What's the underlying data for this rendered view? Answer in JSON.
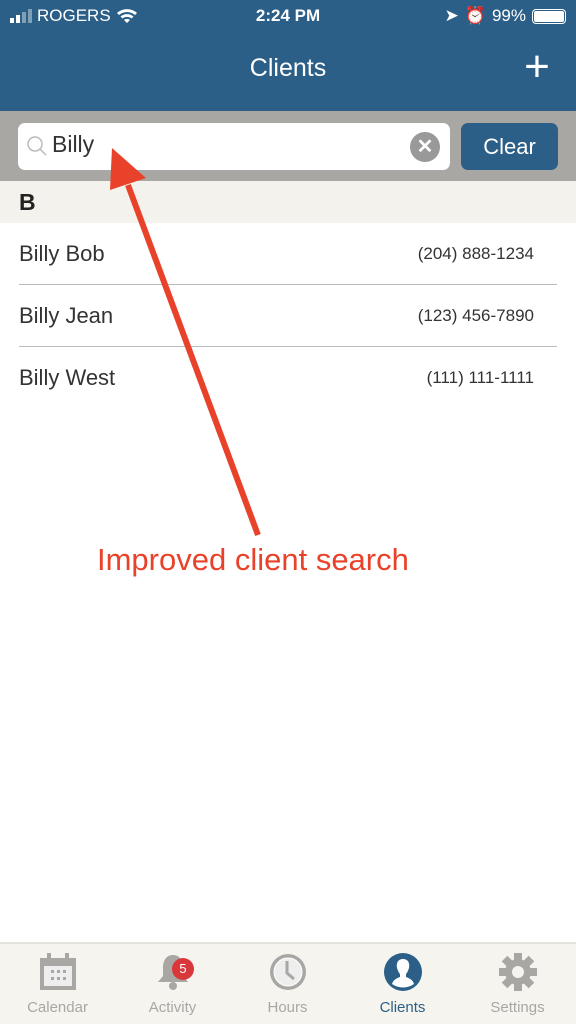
{
  "status": {
    "carrier": "ROGERS",
    "time": "2:24 PM",
    "battery": "99%",
    "battery_level": 0.99
  },
  "header": {
    "title": "Clients",
    "add_icon": "plus-icon"
  },
  "search": {
    "value": "Billy",
    "placeholder": "",
    "clear_label": "Clear"
  },
  "section": "B",
  "clients": [
    {
      "name": "Billy Bob",
      "phone": "(204) 888-1234"
    },
    {
      "name": "Billy Jean",
      "phone": "(123) 456-7890"
    },
    {
      "name": "Billy West",
      "phone": "(111) 111-1111"
    }
  ],
  "annotation": "Improved client search",
  "colors": {
    "header": "#2b5f87",
    "annotation": "#e8432a",
    "badge": "#d9383a"
  },
  "tabs": [
    {
      "label": "Calendar"
    },
    {
      "label": "Activity",
      "badge": "5"
    },
    {
      "label": "Hours"
    },
    {
      "label": "Clients",
      "active": true
    },
    {
      "label": "Settings"
    }
  ]
}
